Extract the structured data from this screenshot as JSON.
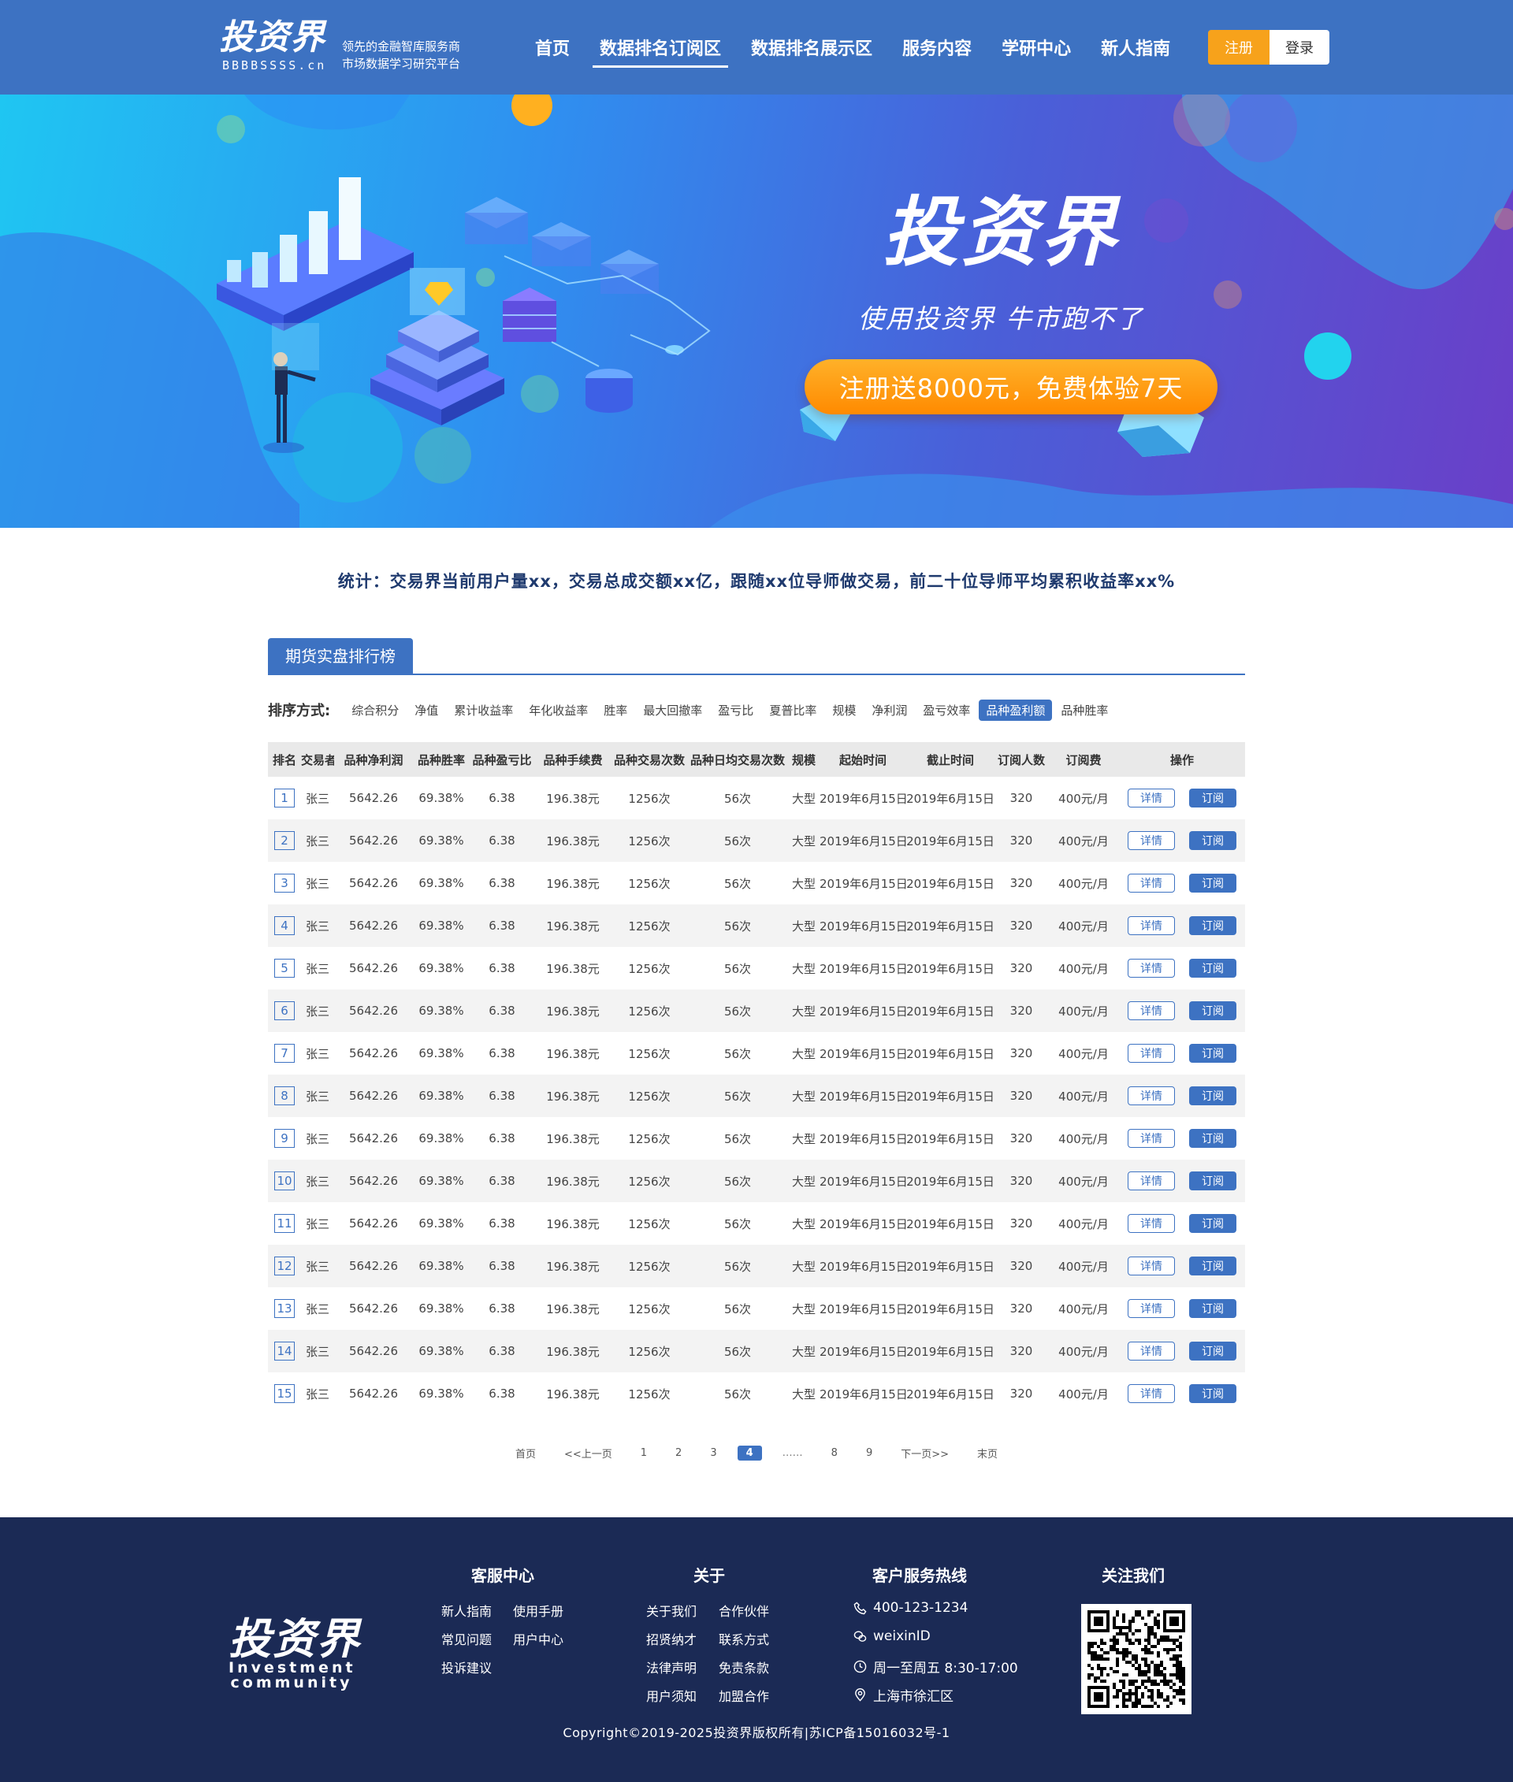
{
  "header": {
    "logo_text": "投资界",
    "logo_sub": "BBBBSSSS.cn",
    "slogan_line1": "领先的金融智库服务商",
    "slogan_line2": "市场数据学习研究平台",
    "nav": [
      {
        "label": "首页",
        "active": false
      },
      {
        "label": "数据排名订阅区",
        "active": true
      },
      {
        "label": "数据排名展示区",
        "active": false
      },
      {
        "label": "服务内容",
        "active": false
      },
      {
        "label": "学研中心",
        "active": false
      },
      {
        "label": "新人指南",
        "active": false
      }
    ],
    "register_label": "注册",
    "login_label": "登录"
  },
  "banner": {
    "title": "投资界",
    "subtitle": "使用投资界  牛市跑不了",
    "cta": "注册送8000元，免费体验7天"
  },
  "stats_text": "统计：交易界当前用户量xx，交易总成交额xx亿，跟随xx位导师做交易，前二十位导师平均累积收益率xx%",
  "section_tab": "期货实盘排行榜",
  "sort": {
    "label": "排序方式:",
    "options": [
      "综合积分",
      "净值",
      "累计收益率",
      "年化收益率",
      "胜率",
      "最大回撤率",
      "盈亏比",
      "夏普比率",
      "规模",
      "净利润",
      "盈亏效率",
      "品种盈利额",
      "品种胜率"
    ],
    "active_index": 11
  },
  "table": {
    "headers": [
      "排名",
      "交易者",
      "品种净利润",
      "品种胜率",
      "品种盈亏比",
      "品种手续费",
      "品种交易次数",
      "品种日均交易次数",
      "规模",
      "起始时间",
      "截止时间",
      "订阅人数",
      "订阅费",
      "操作"
    ],
    "detail_label": "详情",
    "subscribe_label": "订阅",
    "rows": [
      {
        "rank": "1",
        "trader": "张三",
        "net_profit": "5642.26",
        "win_rate": "69.38%",
        "pl_ratio": "6.38",
        "fee": "196.38元",
        "trades": "1256次",
        "daily_trades": "56次",
        "scale": "大型",
        "start": "2019年6月15日",
        "end": "2019年6月15日",
        "subscribers": "320",
        "price": "400元/月"
      },
      {
        "rank": "2",
        "trader": "张三",
        "net_profit": "5642.26",
        "win_rate": "69.38%",
        "pl_ratio": "6.38",
        "fee": "196.38元",
        "trades": "1256次",
        "daily_trades": "56次",
        "scale": "大型",
        "start": "2019年6月15日",
        "end": "2019年6月15日",
        "subscribers": "320",
        "price": "400元/月"
      },
      {
        "rank": "3",
        "trader": "张三",
        "net_profit": "5642.26",
        "win_rate": "69.38%",
        "pl_ratio": "6.38",
        "fee": "196.38元",
        "trades": "1256次",
        "daily_trades": "56次",
        "scale": "大型",
        "start": "2019年6月15日",
        "end": "2019年6月15日",
        "subscribers": "320",
        "price": "400元/月"
      },
      {
        "rank": "4",
        "trader": "张三",
        "net_profit": "5642.26",
        "win_rate": "69.38%",
        "pl_ratio": "6.38",
        "fee": "196.38元",
        "trades": "1256次",
        "daily_trades": "56次",
        "scale": "大型",
        "start": "2019年6月15日",
        "end": "2019年6月15日",
        "subscribers": "320",
        "price": "400元/月"
      },
      {
        "rank": "5",
        "trader": "张三",
        "net_profit": "5642.26",
        "win_rate": "69.38%",
        "pl_ratio": "6.38",
        "fee": "196.38元",
        "trades": "1256次",
        "daily_trades": "56次",
        "scale": "大型",
        "start": "2019年6月15日",
        "end": "2019年6月15日",
        "subscribers": "320",
        "price": "400元/月"
      },
      {
        "rank": "6",
        "trader": "张三",
        "net_profit": "5642.26",
        "win_rate": "69.38%",
        "pl_ratio": "6.38",
        "fee": "196.38元",
        "trades": "1256次",
        "daily_trades": "56次",
        "scale": "大型",
        "start": "2019年6月15日",
        "end": "2019年6月15日",
        "subscribers": "320",
        "price": "400元/月"
      },
      {
        "rank": "7",
        "trader": "张三",
        "net_profit": "5642.26",
        "win_rate": "69.38%",
        "pl_ratio": "6.38",
        "fee": "196.38元",
        "trades": "1256次",
        "daily_trades": "56次",
        "scale": "大型",
        "start": "2019年6月15日",
        "end": "2019年6月15日",
        "subscribers": "320",
        "price": "400元/月"
      },
      {
        "rank": "8",
        "trader": "张三",
        "net_profit": "5642.26",
        "win_rate": "69.38%",
        "pl_ratio": "6.38",
        "fee": "196.38元",
        "trades": "1256次",
        "daily_trades": "56次",
        "scale": "大型",
        "start": "2019年6月15日",
        "end": "2019年6月15日",
        "subscribers": "320",
        "price": "400元/月"
      },
      {
        "rank": "9",
        "trader": "张三",
        "net_profit": "5642.26",
        "win_rate": "69.38%",
        "pl_ratio": "6.38",
        "fee": "196.38元",
        "trades": "1256次",
        "daily_trades": "56次",
        "scale": "大型",
        "start": "2019年6月15日",
        "end": "2019年6月15日",
        "subscribers": "320",
        "price": "400元/月"
      },
      {
        "rank": "10",
        "trader": "张三",
        "net_profit": "5642.26",
        "win_rate": "69.38%",
        "pl_ratio": "6.38",
        "fee": "196.38元",
        "trades": "1256次",
        "daily_trades": "56次",
        "scale": "大型",
        "start": "2019年6月15日",
        "end": "2019年6月15日",
        "subscribers": "320",
        "price": "400元/月"
      },
      {
        "rank": "11",
        "trader": "张三",
        "net_profit": "5642.26",
        "win_rate": "69.38%",
        "pl_ratio": "6.38",
        "fee": "196.38元",
        "trades": "1256次",
        "daily_trades": "56次",
        "scale": "大型",
        "start": "2019年6月15日",
        "end": "2019年6月15日",
        "subscribers": "320",
        "price": "400元/月"
      },
      {
        "rank": "12",
        "trader": "张三",
        "net_profit": "5642.26",
        "win_rate": "69.38%",
        "pl_ratio": "6.38",
        "fee": "196.38元",
        "trades": "1256次",
        "daily_trades": "56次",
        "scale": "大型",
        "start": "2019年6月15日",
        "end": "2019年6月15日",
        "subscribers": "320",
        "price": "400元/月"
      },
      {
        "rank": "13",
        "trader": "张三",
        "net_profit": "5642.26",
        "win_rate": "69.38%",
        "pl_ratio": "6.38",
        "fee": "196.38元",
        "trades": "1256次",
        "daily_trades": "56次",
        "scale": "大型",
        "start": "2019年6月15日",
        "end": "2019年6月15日",
        "subscribers": "320",
        "price": "400元/月"
      },
      {
        "rank": "14",
        "trader": "张三",
        "net_profit": "5642.26",
        "win_rate": "69.38%",
        "pl_ratio": "6.38",
        "fee": "196.38元",
        "trades": "1256次",
        "daily_trades": "56次",
        "scale": "大型",
        "start": "2019年6月15日",
        "end": "2019年6月15日",
        "subscribers": "320",
        "price": "400元/月"
      },
      {
        "rank": "15",
        "trader": "张三",
        "net_profit": "5642.26",
        "win_rate": "69.38%",
        "pl_ratio": "6.38",
        "fee": "196.38元",
        "trades": "1256次",
        "daily_trades": "56次",
        "scale": "大型",
        "start": "2019年6月15日",
        "end": "2019年6月15日",
        "subscribers": "320",
        "price": "400元/月"
      }
    ]
  },
  "pagination": {
    "first": "首页",
    "prev": "<<上一页",
    "pages": [
      "1",
      "2",
      "3",
      "4",
      "……",
      "8",
      "9"
    ],
    "current": "4",
    "next": "下一页>>",
    "last": "末页"
  },
  "footer": {
    "logo_text": "投资界",
    "logo_en_line1": "Investment",
    "logo_en_line2": "community",
    "service_title": "客服中心",
    "service_links": [
      "新人指南",
      "使用手册",
      "常见问题",
      "用户中心",
      "投诉建议"
    ],
    "about_title": "关于",
    "about_links": [
      "关于我们",
      "合作伙伴",
      "招贤纳才",
      "联系方式",
      "法律声明",
      "免责条款",
      "用户须知",
      "加盟合作"
    ],
    "hotline_title": "客户服务热线",
    "phone": "400-123-1234",
    "wechat": "weixinID",
    "hours": "周一至周五 8:30-17:00",
    "address": "上海市徐汇区",
    "follow_title": "关注我们",
    "copyright": "Copyright©2019-2025投资界版权所有|苏ICP备15016032号-1"
  },
  "colors": {
    "primary": "#3d72c2",
    "accent_orange": "#f7a21b",
    "footer_bg": "#1b2a55"
  }
}
